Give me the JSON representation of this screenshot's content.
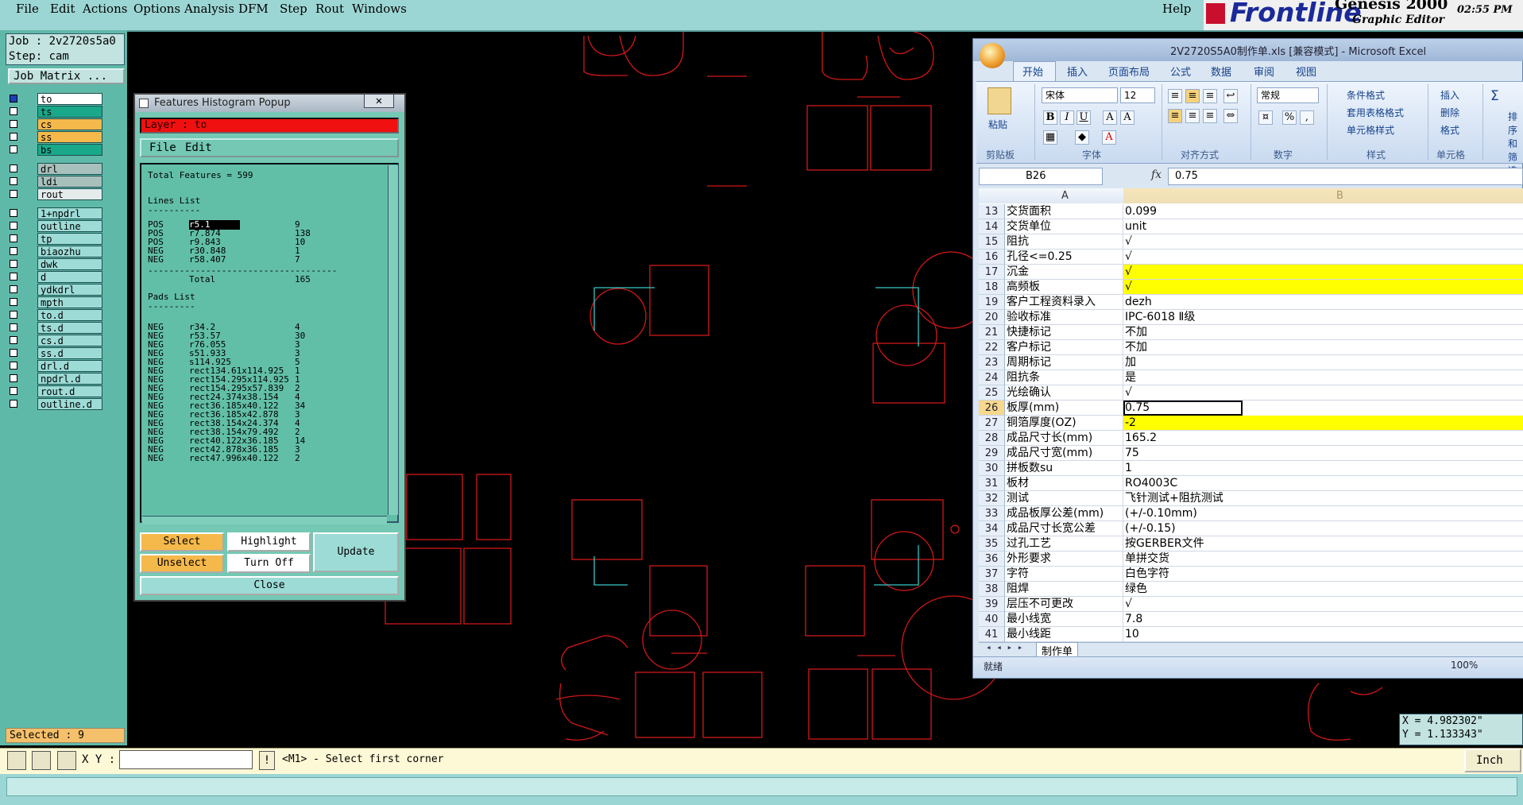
{
  "menubar": {
    "items": [
      "File",
      "Edit",
      "Actions",
      "Options",
      "Analysis",
      "DFM",
      "Step",
      "Rout",
      "Windows"
    ],
    "help": "Help"
  },
  "brand": {
    "name": "Frontline",
    "product": "Genesis 2000",
    "subtitle": "Graphic Editor",
    "time": "02:55 PM"
  },
  "job": {
    "job_line": "Job : 2v2720s5a0",
    "step_line": "Step: cam",
    "matrix_button": "Job Matrix ..."
  },
  "layers": [
    {
      "name": "to",
      "color": "#ffffff",
      "checked": true
    },
    {
      "name": "ts",
      "color": "#1aa88a",
      "checked": false
    },
    {
      "name": "cs",
      "color": "#f5b84a",
      "checked": false
    },
    {
      "name": "ss",
      "color": "#f5b84a",
      "checked": false
    },
    {
      "name": "bs",
      "color": "#1aa88a",
      "checked": false
    },
    {
      "name": "drl",
      "color": "#a8c0bc",
      "checked": false
    },
    {
      "name": "ldi",
      "color": "#a8c0bc",
      "checked": false
    },
    {
      "name": "rout",
      "color": "#e4eceb",
      "checked": false
    },
    {
      "name": "1+npdrl",
      "color": "#9ddbd6",
      "checked": false
    },
    {
      "name": "outline",
      "color": "#9ddbd6",
      "checked": false
    },
    {
      "name": "tp",
      "color": "#9ddbd6",
      "checked": false
    },
    {
      "name": "biaozhu",
      "color": "#9ddbd6",
      "checked": false
    },
    {
      "name": "dwk",
      "color": "#9ddbd6",
      "checked": false
    },
    {
      "name": "d",
      "color": "#9ddbd6",
      "checked": false
    },
    {
      "name": "ydkdrl",
      "color": "#9ddbd6",
      "checked": false
    },
    {
      "name": "mpth",
      "color": "#9ddbd6",
      "checked": false
    },
    {
      "name": "to.d",
      "color": "#9ddbd6",
      "checked": false
    },
    {
      "name": "ts.d",
      "color": "#9ddbd6",
      "checked": false
    },
    {
      "name": "cs.d",
      "color": "#9ddbd6",
      "checked": false
    },
    {
      "name": "ss.d",
      "color": "#9ddbd6",
      "checked": false
    },
    {
      "name": "drl.d",
      "color": "#9ddbd6",
      "checked": false
    },
    {
      "name": "npdrl.d",
      "color": "#9ddbd6",
      "checked": false
    },
    {
      "name": "rout.d",
      "color": "#9ddbd6",
      "checked": false
    },
    {
      "name": "outline.d",
      "color": "#9ddbd6",
      "checked": false
    }
  ],
  "selected": "Selected : 9",
  "popup": {
    "title": "Features Histogram Popup",
    "close_x": "✕",
    "layer": "Layer :  to",
    "menu": [
      "File",
      "Edit"
    ],
    "total_features": "Total Features = 599",
    "lines_header": "Lines List",
    "lines": [
      {
        "pol": "POS",
        "sym": "r5.1",
        "count": "9"
      },
      {
        "pol": "POS",
        "sym": "r7.874",
        "count": "138"
      },
      {
        "pol": "POS",
        "sym": "r9.843",
        "count": "10"
      },
      {
        "pol": "NEG",
        "sym": "r30.848",
        "count": "1"
      },
      {
        "pol": "NEG",
        "sym": "r58.407",
        "count": "7"
      }
    ],
    "total_label": "Total",
    "total_value": "165",
    "pads_header": "Pads List",
    "pads": [
      {
        "pol": "NEG",
        "sym": "r34.2",
        "count": "4"
      },
      {
        "pol": "NEG",
        "sym": "r53.57",
        "count": "30"
      },
      {
        "pol": "NEG",
        "sym": "r76.055",
        "count": "3"
      },
      {
        "pol": "NEG",
        "sym": "s51.933",
        "count": "3"
      },
      {
        "pol": "NEG",
        "sym": "s114.925",
        "count": "5"
      },
      {
        "pol": "NEG",
        "sym": "rect134.61x114.925",
        "count": "1"
      },
      {
        "pol": "NEG",
        "sym": "rect154.295x114.925",
        "count": "1"
      },
      {
        "pol": "NEG",
        "sym": "rect154.295x57.839",
        "count": "2"
      },
      {
        "pol": "NEG",
        "sym": "rect24.374x38.154",
        "count": "4"
      },
      {
        "pol": "NEG",
        "sym": "rect36.185x40.122",
        "count": "34"
      },
      {
        "pol": "NEG",
        "sym": "rect36.185x42.878",
        "count": "3"
      },
      {
        "pol": "NEG",
        "sym": "rect38.154x24.374",
        "count": "4"
      },
      {
        "pol": "NEG",
        "sym": "rect38.154x79.492",
        "count": "2"
      },
      {
        "pol": "NEG",
        "sym": "rect40.122x36.185",
        "count": "14"
      },
      {
        "pol": "NEG",
        "sym": "rect42.878x36.185",
        "count": "3"
      },
      {
        "pol": "NEG",
        "sym": "rect47.996x40.122",
        "count": "2"
      }
    ],
    "buttons": {
      "select": "Select",
      "highlight": "Highlight",
      "update": "Update",
      "unselect": "Unselect",
      "turn_off": "Turn Off",
      "close": "Close"
    }
  },
  "cmdbar": {
    "xy_label": "X Y :",
    "xy_value": "",
    "excl": "!",
    "prompt": "<M1> - Select first corner",
    "unit": "Inch"
  },
  "coords": {
    "x": "X = 4.982302\"",
    "y": "Y = 1.133343\""
  },
  "excel": {
    "title": "2V2720S5A0制作单.xls  [兼容模式] - Microsoft Excel",
    "tabs": [
      "开始",
      "插入",
      "页面布局",
      "公式",
      "数据",
      "审阅",
      "视图"
    ],
    "ribbon": {
      "paste": "粘贴",
      "font_name": "宋体",
      "font_size": "12",
      "number_format": "常规",
      "cond_format": "条件格式",
      "table_format": "套用表格格式",
      "cell_style": "单元格样式",
      "insert": "插入",
      "delete": "删除",
      "format": "格式",
      "sort": "排序和筛选",
      "groups": [
        "剪贴板",
        "字体",
        "对齐方式",
        "数字",
        "样式",
        "单元格"
      ]
    },
    "name_box": "B26",
    "fx": "fx",
    "formula": "0.75",
    "col_a": "A",
    "col_b": "B",
    "rows": [
      {
        "n": "13",
        "a": "交货面积",
        "b": "0.099",
        "yellow": false
      },
      {
        "n": "14",
        "a": "交货单位",
        "b": "unit",
        "yellow": false
      },
      {
        "n": "15",
        "a": "阻抗",
        "b": "√",
        "yellow": false
      },
      {
        "n": "16",
        "a": "孔径<=0.25",
        "b": "√",
        "yellow": false
      },
      {
        "n": "17",
        "a": "沉金",
        "b": "√",
        "yellow": true
      },
      {
        "n": "18",
        "a": "高频板",
        "b": "√",
        "yellow": true
      },
      {
        "n": "19",
        "a": "客户工程资料录入",
        "b": "dezh",
        "yellow": false
      },
      {
        "n": "20",
        "a": "验收标准",
        "b": "IPC-6018 Ⅱ级",
        "yellow": false
      },
      {
        "n": "21",
        "a": "快捷标记",
        "b": "不加",
        "yellow": false
      },
      {
        "n": "22",
        "a": "客户标记",
        "b": "不加",
        "yellow": false
      },
      {
        "n": "23",
        "a": "周期标记",
        "b": "加",
        "yellow": false
      },
      {
        "n": "24",
        "a": "阻抗条",
        "b": "是",
        "yellow": false
      },
      {
        "n": "25",
        "a": "光绘确认",
        "b": "√",
        "yellow": false
      },
      {
        "n": "26",
        "a": "板厚(mm)",
        "b": "0.75",
        "yellow": false
      },
      {
        "n": "27",
        "a": "铜箔厚度(OZ)",
        "b": "-2",
        "yellow": true
      },
      {
        "n": "28",
        "a": "成品尺寸长(mm)",
        "b": "165.2",
        "yellow": false
      },
      {
        "n": "29",
        "a": "成品尺寸宽(mm)",
        "b": "75",
        "yellow": false
      },
      {
        "n": "30",
        "a": "拼板数su",
        "b": "1",
        "yellow": false
      },
      {
        "n": "31",
        "a": "板材",
        "b": "RO4003C",
        "yellow": false
      },
      {
        "n": "32",
        "a": "测试",
        "b": "飞针测试+阻抗测试",
        "yellow": false
      },
      {
        "n": "33",
        "a": "成品板厚公差(mm)",
        "b": "(+/-0.10mm)",
        "yellow": false
      },
      {
        "n": "34",
        "a": "成品尺寸长宽公差",
        "b": "(+/-0.15)",
        "yellow": false
      },
      {
        "n": "35",
        "a": "过孔工艺",
        "b": "按GERBER文件",
        "yellow": false
      },
      {
        "n": "36",
        "a": "外形要求",
        "b": "单拼交货",
        "yellow": false
      },
      {
        "n": "37",
        "a": "字符",
        "b": "白色字符",
        "yellow": false
      },
      {
        "n": "38",
        "a": "阻焊",
        "b": "绿色",
        "yellow": false
      },
      {
        "n": "39",
        "a": "层压不可更改",
        "b": "√",
        "yellow": false
      },
      {
        "n": "40",
        "a": "最小线宽",
        "b": "7.8",
        "yellow": false
      },
      {
        "n": "41",
        "a": "最小线距",
        "b": "10",
        "yellow": false
      }
    ],
    "sheet_tab": "制作单",
    "status": "就绪",
    "zoom": "100%"
  }
}
